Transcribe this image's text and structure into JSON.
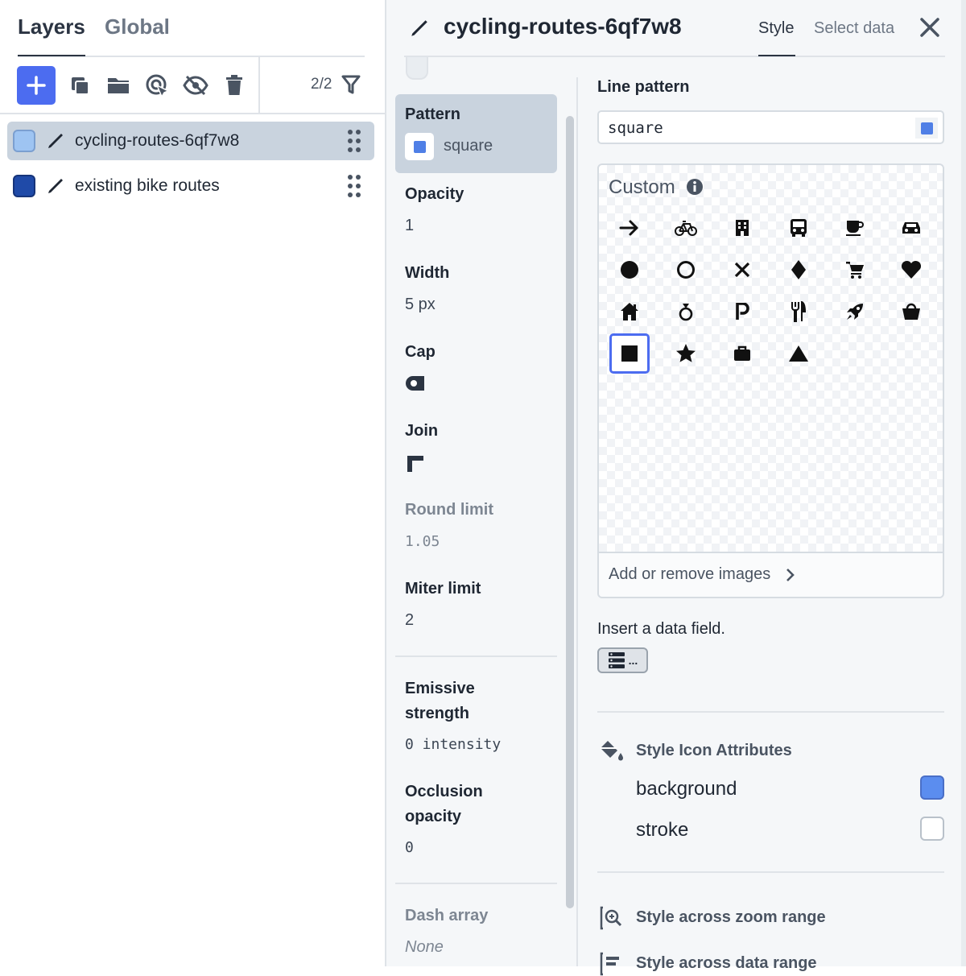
{
  "left_tabs": {
    "layers": "Layers",
    "global": "Global"
  },
  "toolbar": {
    "counter": "2/2"
  },
  "layers": [
    {
      "name": "cycling-routes-6qf7w8",
      "color": "#9ec4f2",
      "selected": true
    },
    {
      "name": "existing bike routes",
      "color": "#1f4aa8",
      "selected": false
    }
  ],
  "header": {
    "title": "cycling-routes-6qf7w8",
    "tab_style": "Style",
    "tab_select": "Select data"
  },
  "props": {
    "pattern_label": "Pattern",
    "pattern_value": "square",
    "opacity_label": "Opacity",
    "opacity_value": "1",
    "width_label": "Width",
    "width_value": "5 px",
    "cap_label": "Cap",
    "join_label": "Join",
    "round_limit_label": "Round limit",
    "round_limit_value": "1.05",
    "miter_limit_label": "Miter limit",
    "miter_limit_value": "2",
    "emissive_label_1": "Emissive",
    "emissive_label_2": "strength",
    "emissive_value": "0 intensity",
    "occlusion_label_1": "Occlusion",
    "occlusion_label_2": "opacity",
    "occlusion_value": "0",
    "dash_label": "Dash array",
    "dash_value": "None"
  },
  "editor": {
    "label": "Line pattern",
    "input_value": "square",
    "panel_title": "Custom",
    "footer": "Add or remove images",
    "insert_text": "Insert a data field.",
    "insert_btn": "...",
    "icons": [
      "arrow-right-icon",
      "bicycle-icon",
      "building-icon",
      "bus-icon",
      "coffee-icon",
      "car-icon",
      "circle-icon",
      "circle-stroked-icon",
      "cross-icon",
      "diamond-icon",
      "cart-icon",
      "heart-icon",
      "home-icon",
      "ring-icon",
      "parking-icon",
      "restaurant-icon",
      "rocket-icon",
      "shop-icon",
      "square-icon",
      "star-icon",
      "suitcase-icon",
      "triangle-icon"
    ],
    "selected_icon": "square-icon"
  },
  "icon_attrs": {
    "title": "Style Icon Attributes",
    "background_label": "background",
    "background_color": "#5b8def",
    "stroke_label": "stroke"
  },
  "sections": {
    "zoom": "Style across zoom range",
    "data": "Style across data range"
  }
}
